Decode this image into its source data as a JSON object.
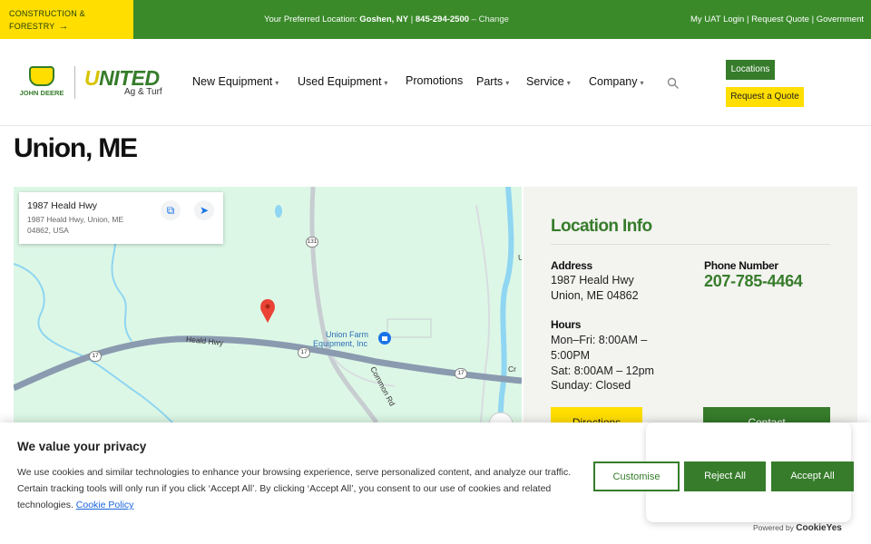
{
  "topbar": {
    "construction_label_1": "CONSTRUCTION &",
    "construction_label_2": "FORESTRY",
    "construction_arrow": "→",
    "preferred_prefix": "Your Preferred Location: ",
    "preferred_location": "Goshen, NY",
    "separator": " | ",
    "preferred_phone": "845-294-2500",
    "change_label": " – Change",
    "links": [
      "My UAT Login",
      "Request Quote",
      "Government"
    ]
  },
  "header": {
    "jd_logo_text": "JOHN DEERE",
    "united_logo_u": "U",
    "united_logo_rest": "NITED",
    "united_logo_sub": "Ag & Turf",
    "nav": [
      {
        "label": "New Equipment",
        "caret": "▾"
      },
      {
        "label": "Used Equipment",
        "caret": "▾"
      },
      {
        "label": "Promotions",
        "caret": ""
      },
      {
        "label": "Parts",
        "caret": "▾"
      },
      {
        "label": "Service",
        "caret": "▾"
      },
      {
        "label": "Company",
        "caret": "▾"
      }
    ],
    "locations_button": "Locations",
    "request_quote_button": "Request a Quote"
  },
  "page": {
    "title": "Union, ME"
  },
  "map": {
    "place_title": "1987 Heald Hwy",
    "place_address": "1987 Heald Hwy, Union, ME 04862, USA",
    "business_label_1": "Union Farm",
    "business_label_2": "Equipment, Inc",
    "road_heald": "Heald Hwy",
    "road_common": "Common Rd",
    "route_17": "17",
    "route_131": "131",
    "edge_label_cr": "Cr",
    "edge_label_u": "U"
  },
  "location_info": {
    "title": "Location Info",
    "address_label": "Address",
    "address_line1": "1987 Heald Hwy",
    "address_line2": "Union, ME 04862",
    "phone_label": "Phone Number",
    "phone": "207-785-4464",
    "hours_label": "Hours",
    "hours_line1": "Mon–Fri: 8:00AM –",
    "hours_line2": "5:00PM",
    "hours_line3": "Sat: 8:00AM – 12pm",
    "hours_line4": "Sunday: Closed",
    "directions_button": "Directions",
    "contact_button": "Contact"
  },
  "cookie": {
    "title": "We value your privacy",
    "text": "We use cookies and similar technologies to enhance your browsing experience, serve personalized content, and analyze our traffic. Certain tracking tools will only run if you click ‘Accept All’. By clicking ‘Accept All’, you consent to our use of cookies and related technologies. ",
    "policy_link": "Cookie Policy",
    "customise": "Customise",
    "reject": "Reject All",
    "accept": "Accept All",
    "powered_by": "Powered by ",
    "powered_brand": "CookieYes"
  },
  "colors": {
    "brand_green": "#367c2b",
    "brand_yellow": "#ffde00",
    "topbar_green": "#3a8a2a",
    "map_bg": "#ddf7e6"
  }
}
